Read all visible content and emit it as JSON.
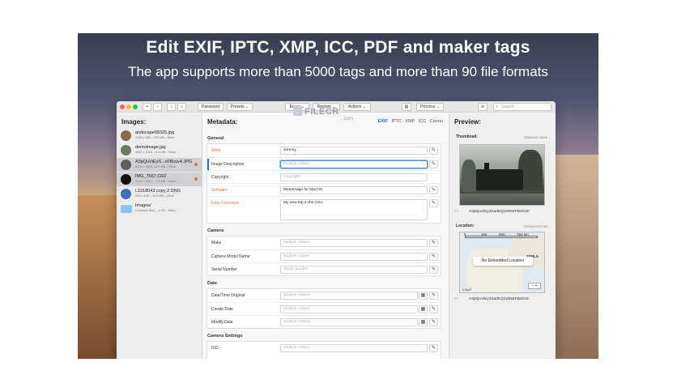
{
  "banner": {
    "headline": "Edit EXIF, IPTC, XMP, ICC, PDF and maker tags",
    "subline": "The app supports more than 5000 tags and more than 90 file formats"
  },
  "toolbar": {
    "plus": "+",
    "minus": "−",
    "back": "‹",
    "forward": "›",
    "password": "Password",
    "presets": "Presets ⌄",
    "erase": "Erase ⌄",
    "restore": "Restore ⌄",
    "actions": "Actions ⌄",
    "view_icon": "▤",
    "process": "Process ⌄",
    "settings_icon": "⊝",
    "search_placeholder": "Search",
    "search_icon": "⌕"
  },
  "images": {
    "title": "Images:",
    "items": [
      {
        "name": "andscape68325.jpg",
        "meta": "1238 x 688 – 370 KB – More",
        "color": "#8a6a48"
      },
      {
        "name": "demoimage.jpg",
        "meta": "4962 x 3328 – 3.3 MB – More",
        "color": "#6f7a62"
      },
      {
        "name": "A3pQuViEyS...vFBcuv4.JPG",
        "meta": "6000 x 4000 – 8.5 MB – More",
        "color": "#5c5f5c"
      },
      {
        "name": "IMG_7667.CR2",
        "meta": "4416 x 3312 – 7.0 MB – More",
        "color": "#101010"
      },
      {
        "name": "L1018043 copy 2.DNG",
        "meta": "222 x 245 – 10.9 MB – More",
        "color": "#3d6fbf"
      },
      {
        "name": "Images/",
        "meta": "Unknown Size – 1 KB – More",
        "color": "#8ec3ee"
      }
    ]
  },
  "metadata": {
    "title": "Metadata:",
    "tabs": [
      "EXIF",
      "IPTC",
      "XMP",
      "ICC",
      "Canon"
    ],
    "general": {
      "title": "General",
      "rows": [
        {
          "label": "Artist",
          "value": "Jeremy"
        },
        {
          "label": "Image Description",
          "placeholder": "Multiple Values"
        },
        {
          "label": "Copyright",
          "placeholder": "Copyright"
        },
        {
          "label": "Software",
          "value": "MetaImage for MacOS"
        },
        {
          "label": "User Comment",
          "value": "My new trip in the USA"
        }
      ]
    },
    "camera": {
      "title": "Camera",
      "rows": [
        {
          "label": "Make",
          "placeholder": "Multiple Values"
        },
        {
          "label": "Camera Model Name",
          "placeholder": "Multiple Values"
        },
        {
          "label": "Serial Number",
          "placeholder": "Serial Number"
        }
      ]
    },
    "date": {
      "title": "Date",
      "rows": [
        {
          "label": "Date/Time Original",
          "placeholder": "Multiple Values"
        },
        {
          "label": "Create Date",
          "placeholder": "Multiple Values"
        },
        {
          "label": "Modify Date",
          "placeholder": "Multiple Values"
        }
      ]
    },
    "settings": {
      "title": "Camera Settings",
      "rows": [
        {
          "label": "ISO",
          "placeholder": "Multiple Values"
        }
      ]
    },
    "pen_icon": "✎",
    "calendar_icon": "▦"
  },
  "preview": {
    "title": "Preview:",
    "thumbnail_label": "Thumbnail:",
    "remove_data": "REMOVE DATA",
    "thumb_file": "A3pQuViEyS4adKQ1WNEFB2G2n",
    "location_label": "Location:",
    "show_editor": "SHOW EDITOR",
    "scale": [
      "0",
      "250",
      "500",
      "750 km"
    ],
    "no_location": "No Embedded Location",
    "map_city": "ZERLA",
    "map_legal": "Legal",
    "zoom": "− +",
    "location_file": "A3pQuViEyS4adKQ1WNEFB2G2n",
    "nav": "‹  ›"
  },
  "watermark": {
    "brand": "FILECR",
    "suffix": ".com"
  }
}
